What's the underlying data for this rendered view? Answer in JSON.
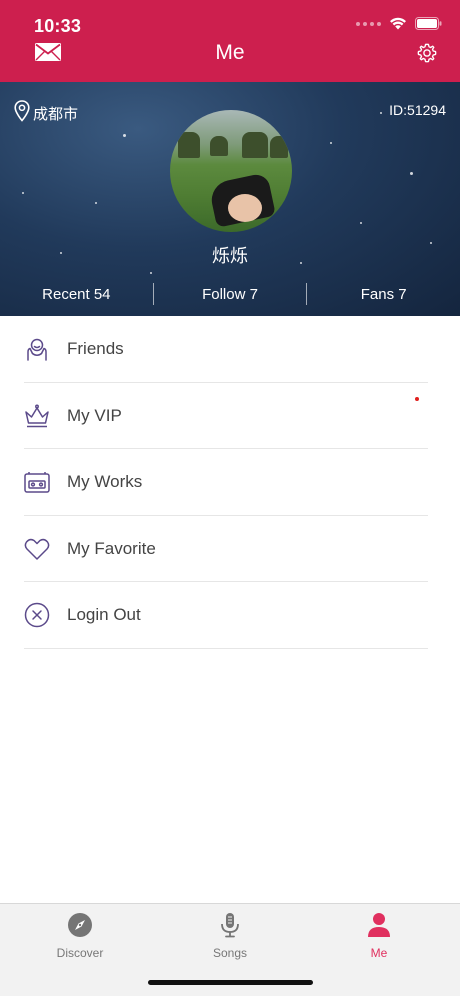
{
  "status_bar": {
    "time": "10:33"
  },
  "nav": {
    "title": "Me"
  },
  "profile": {
    "location": "成都市",
    "user_id": "ID:51294",
    "name": "烁烁",
    "stats": [
      {
        "label": "Recent 54"
      },
      {
        "label": "Follow 7"
      },
      {
        "label": "Fans 7"
      }
    ]
  },
  "menu": {
    "items": [
      {
        "label": "Friends",
        "icon": "friends-icon"
      },
      {
        "label": "My VIP",
        "icon": "crown-icon",
        "has_notification_dot": true
      },
      {
        "label": "My Works",
        "icon": "works-icon"
      },
      {
        "label": "My Favorite",
        "icon": "heart-icon"
      },
      {
        "label": "Login Out",
        "icon": "close-circle-icon"
      }
    ]
  },
  "tabbar": {
    "tabs": [
      {
        "label": "Discover",
        "icon": "compass-icon"
      },
      {
        "label": "Songs",
        "icon": "microphone-icon"
      },
      {
        "label": "Me",
        "icon": "person-icon",
        "active": true
      }
    ]
  },
  "colors": {
    "brand": "#cd1f4e",
    "accent": "#e0305f",
    "menu_icon": "#5b4a8a"
  }
}
